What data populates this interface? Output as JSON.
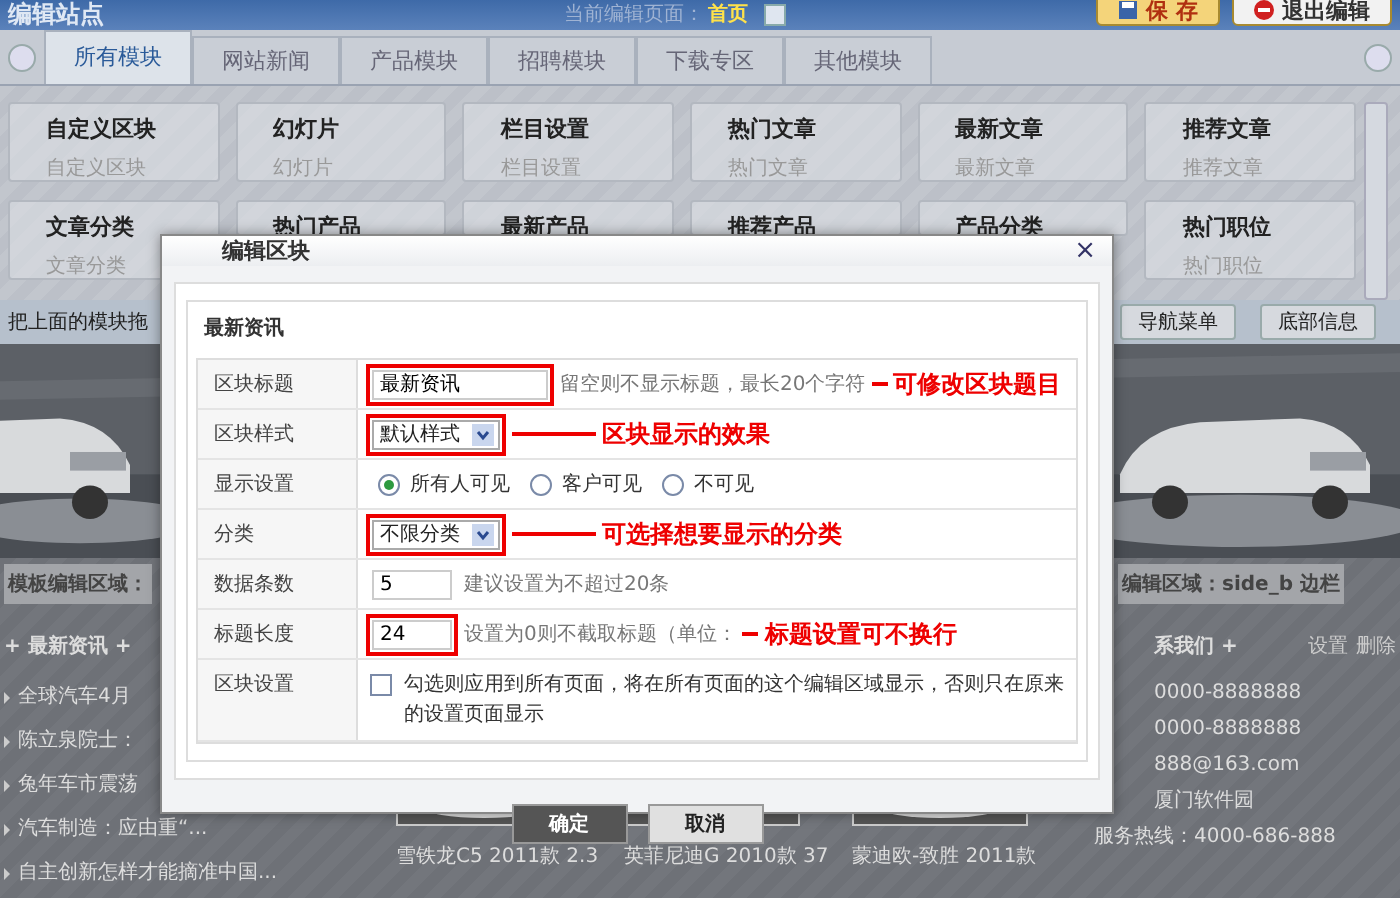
{
  "header": {
    "title": "编辑站点",
    "page_label": "当前编辑页面：",
    "page_value": "首页",
    "buttons": [
      {
        "label": "保 存",
        "kind": "save"
      },
      {
        "label": "退出编辑",
        "kind": "exit"
      }
    ]
  },
  "tabs": [
    {
      "label": "所有模块",
      "selected": true
    },
    {
      "label": "网站新闻",
      "selected": false
    },
    {
      "label": "产品模块",
      "selected": false
    },
    {
      "label": "招聘模块",
      "selected": false
    },
    {
      "label": "下载专区",
      "selected": false
    },
    {
      "label": "其他模块",
      "selected": false
    }
  ],
  "modules": [
    {
      "title": "自定义区块",
      "subtitle": "自定义区块"
    },
    {
      "title": "幻灯片",
      "subtitle": "幻灯片"
    },
    {
      "title": "栏目设置",
      "subtitle": "栏目设置"
    },
    {
      "title": "热门文章",
      "subtitle": "热门文章"
    },
    {
      "title": "最新文章",
      "subtitle": "最新文章"
    },
    {
      "title": "推荐文章",
      "subtitle": "推荐文章"
    },
    {
      "title": "文章分类",
      "subtitle": "文章分类"
    },
    {
      "title": "热门产品"
    },
    {
      "title": "最新产品"
    },
    {
      "title": "推荐产品"
    },
    {
      "title": "产品分类"
    },
    {
      "title": "热门职位",
      "subtitle": "热门职位"
    }
  ],
  "drop_hint": "把上面的模块拖",
  "region_buttons": [
    "导航菜单",
    "底部信息"
  ],
  "left_region": {
    "label": "模板编辑区域：",
    "block_title": "+ 最新资讯 +",
    "news": [
      "全球汽车4月",
      "陈立泉院士：",
      "兔年车市震荡",
      "汽车制造：应由重“...",
      "自主创新怎样才能摘准中国..."
    ]
  },
  "products": [
    {
      "caption": "雪铁龙C5 2011款 2.3"
    },
    {
      "caption": "英菲尼迪G 2010款 37"
    },
    {
      "caption": "蒙迪欧-致胜 2011款"
    }
  ],
  "right_region": {
    "label": "编辑区域：side_b 边栏",
    "block_title": "系我们 +",
    "actions": [
      "设置",
      "删除"
    ],
    "lines": [
      "0000-8888888",
      "0000-8888888",
      "888@163.com",
      "厦门软件园",
      "服务热线：4000-686-888"
    ]
  },
  "dialog": {
    "title": "编辑区块",
    "close": "×",
    "section": "最新资讯",
    "rows": [
      {
        "label": "区块标题",
        "kind": "text",
        "value": "最新资讯",
        "hint": "留空则不显示标题，最长20个字符",
        "annotation": "可修改区块题目"
      },
      {
        "label": "区块样式",
        "kind": "select",
        "value": "默认样式",
        "annotation": "区块显示的效果"
      },
      {
        "label": "显示设置",
        "kind": "radio",
        "options": [
          {
            "label": "所有人可见",
            "selected": true
          },
          {
            "label": "客户可见",
            "selected": false
          },
          {
            "label": "不可见",
            "selected": false
          }
        ]
      },
      {
        "label": "分类",
        "kind": "select",
        "value": "不限分类",
        "annotation": "可选择想要显示的分类"
      },
      {
        "label": "数据条数",
        "kind": "text",
        "value": "5",
        "hint": "建议设置为不超过20条"
      },
      {
        "label": "标题长度",
        "kind": "text",
        "value": "24",
        "hint": "设置为0则不截取标题（单位：",
        "annotation": "标题设置可不换行"
      },
      {
        "label": "区块设置",
        "kind": "checkbox",
        "checked": false,
        "text": "勾选则应用到所有页面，将在所有页面的这个编辑区域显示，否则只在原来的设置页面显示"
      }
    ],
    "buttons": [
      {
        "label": "确定",
        "primary": true
      },
      {
        "label": "取消",
        "primary": false
      }
    ]
  }
}
